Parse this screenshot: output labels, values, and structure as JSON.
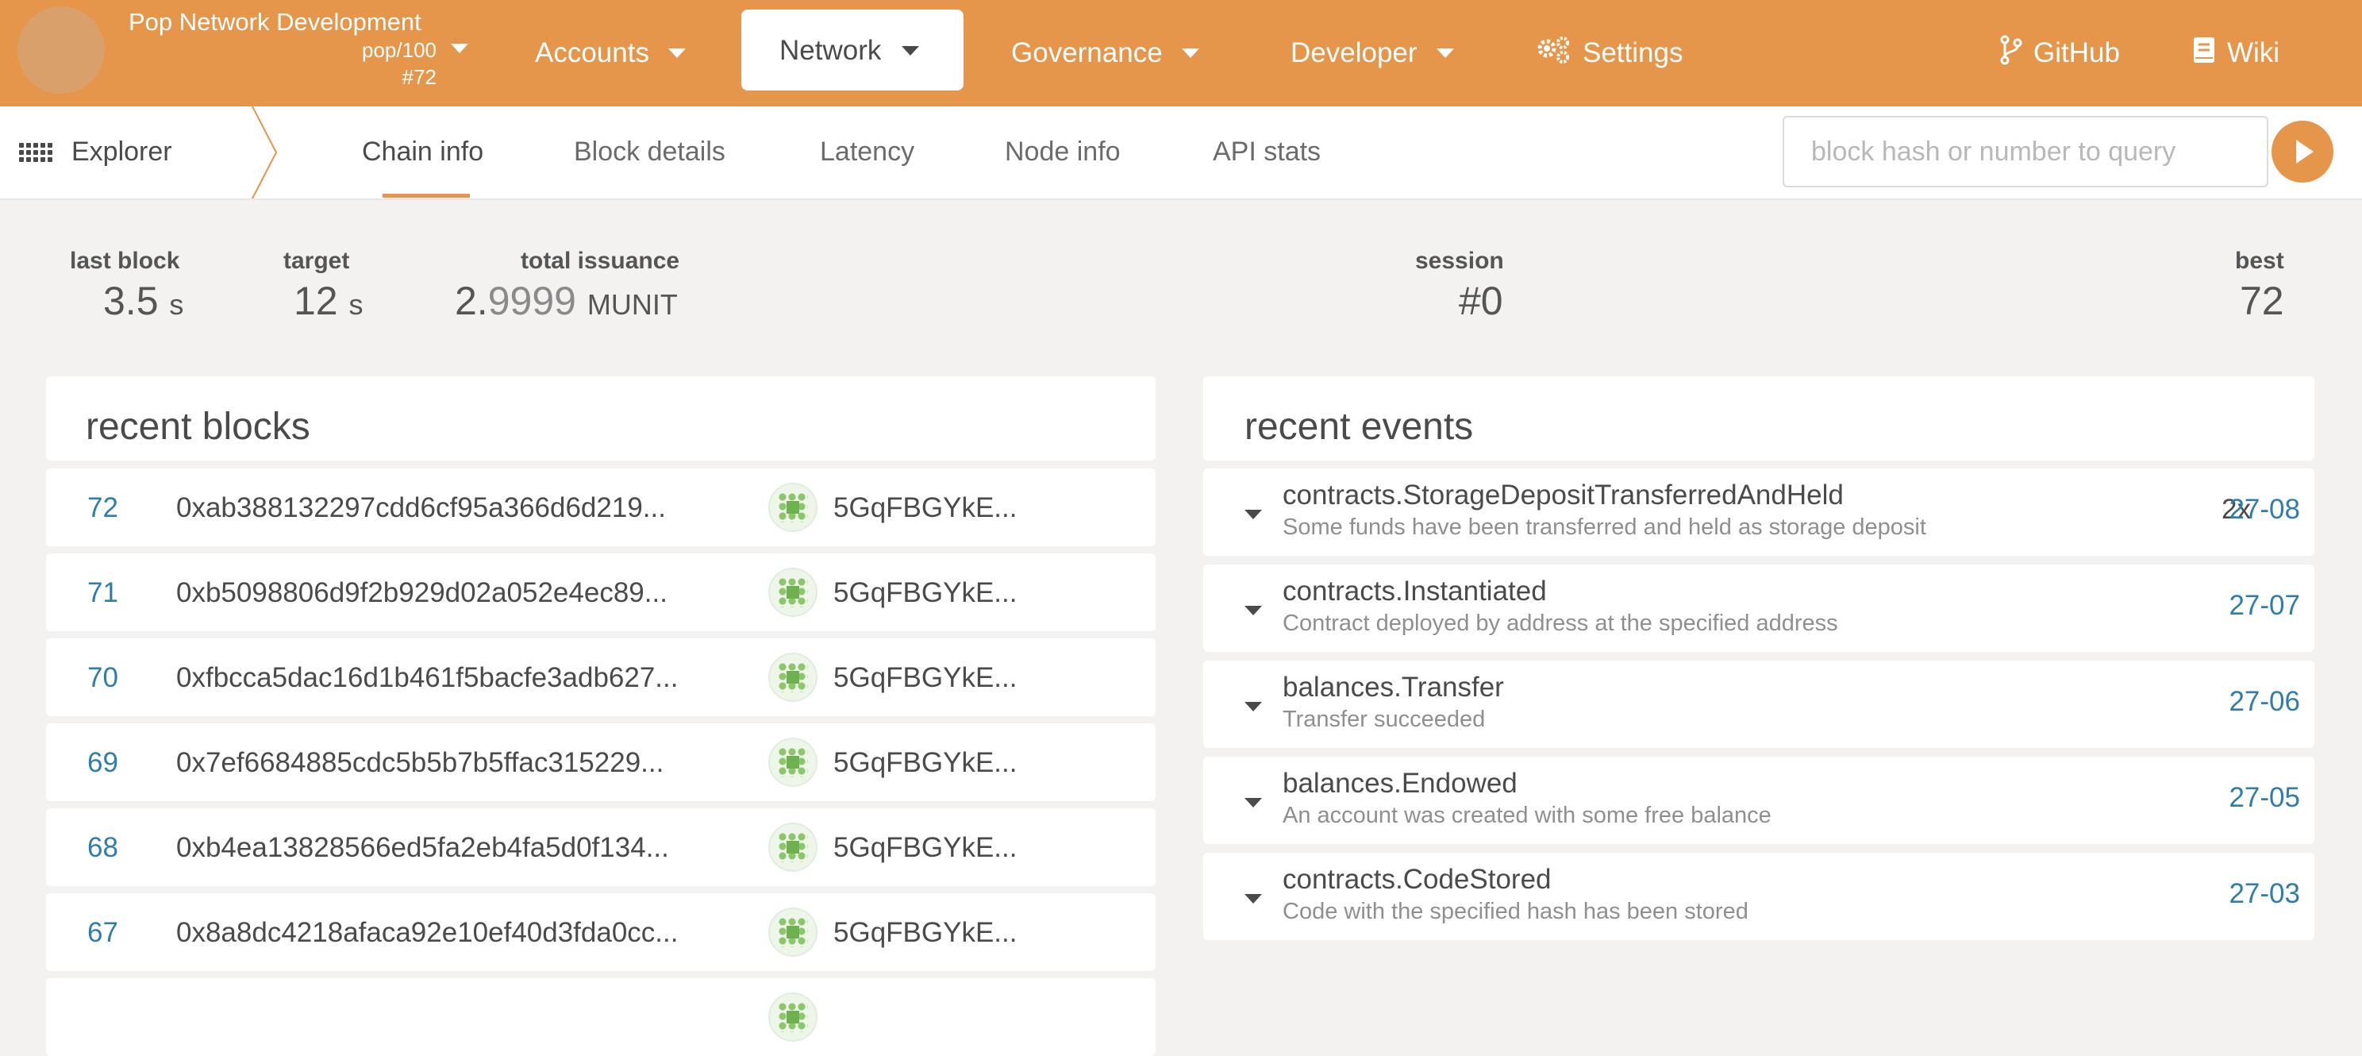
{
  "header": {
    "chain_name": "Pop Network Development",
    "spec": "pop/100",
    "block": "#72",
    "nav": {
      "accounts": "Accounts",
      "network": "Network",
      "governance": "Governance",
      "developer": "Developer",
      "settings": "Settings",
      "github": "GitHub",
      "wiki": "Wiki"
    },
    "accent": "#e6964a"
  },
  "subnav": {
    "section": "Explorer",
    "tabs": [
      "Chain info",
      "Block details",
      "Latency",
      "Node info",
      "API stats"
    ],
    "active_tab": "Chain info",
    "query_placeholder": "block hash or number to query"
  },
  "summary": {
    "last_block": {
      "label": "last block",
      "value": "3.5",
      "unit": "s"
    },
    "target": {
      "label": "target",
      "value": "12",
      "unit": "s"
    },
    "total_issuance": {
      "label": "total issuance",
      "int": "2.",
      "frac": "9999",
      "unit": "MUNIT"
    },
    "session": {
      "label": "session",
      "value": "#0"
    },
    "best": {
      "label": "best",
      "value": "72"
    }
  },
  "recent_blocks": {
    "title": "recent blocks",
    "rows": [
      {
        "number": "72",
        "hash": "0xab388132297cdd6cf95a366d6d219...",
        "author": "5GqFBGYkE..."
      },
      {
        "number": "71",
        "hash": "0xb5098806d9f2b929d02a052e4ec89...",
        "author": "5GqFBGYkE..."
      },
      {
        "number": "70",
        "hash": "0xfbcca5dac16d1b461f5bacfe3adb627...",
        "author": "5GqFBGYkE..."
      },
      {
        "number": "69",
        "hash": "0x7ef6684885cdc5b5b7b5ffac315229...",
        "author": "5GqFBGYkE..."
      },
      {
        "number": "68",
        "hash": "0xb4ea13828566ed5fa2eb4fa5d0f134...",
        "author": "5GqFBGYkE..."
      },
      {
        "number": "67",
        "hash": "0x8a8dc4218afaca92e10ef40d3fda0cc...",
        "author": "5GqFBGYkE..."
      }
    ]
  },
  "recent_events": {
    "title": "recent events",
    "rows": [
      {
        "name": "contracts.StorageDepositTransferredAndHeld",
        "desc": "Some funds have been transferred and held as storage deposit",
        "count": "2x",
        "ref": "27-08"
      },
      {
        "name": "contracts.Instantiated",
        "desc": "Contract deployed by address at the specified address",
        "count": "",
        "ref": "27-07"
      },
      {
        "name": "balances.Transfer",
        "desc": "Transfer succeeded",
        "count": "",
        "ref": "27-06"
      },
      {
        "name": "balances.Endowed",
        "desc": "An account was created with some free balance",
        "count": "",
        "ref": "27-05"
      },
      {
        "name": "contracts.CodeStored",
        "desc": "Code with the specified hash has been stored",
        "count": "",
        "ref": "27-03"
      }
    ]
  }
}
